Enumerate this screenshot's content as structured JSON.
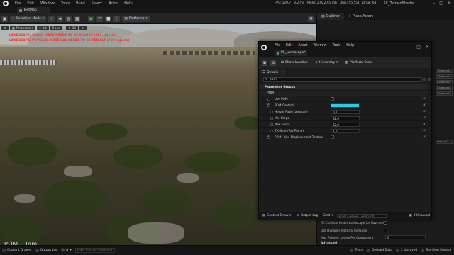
{
  "app": {
    "menu": [
      "File",
      "Edit",
      "Window",
      "Tools",
      "Build",
      "Select",
      "Actor",
      "Help"
    ],
    "stats": [
      "FPS: 120,7",
      "8,2 ms",
      "Mem: 2.022,91 mb",
      "Objs: 45.551",
      "Draw: 63"
    ],
    "project_name": "5C_TerrainShader",
    "map_tab": "TestMap"
  },
  "toolbar": {
    "mode": "Selection Mode",
    "platforms": "Platforms"
  },
  "viewport": {
    "perspective": "Perspective",
    "lit": "Lit",
    "show": "Show",
    "snap_value": "10",
    "warnings": [
      "LANDSCAPE: GRASS MAPS NEEDS TO BE REBUILT (252 objects)",
      "LANDSCAPE: PHYSICAL MATERIAL NEEDS TO BE REBUILT (252 objects)"
    ],
    "watermark": "POM - Tom"
  },
  "right_panel": {
    "tabs": [
      "Outliner",
      "Place Actors"
    ],
    "overflow_labels": [
      "(Orientatio",
      "(Orientatio",
      "(Orientatio",
      "(Orientatio",
      "(Orientatio"
    ],
    "edit_in_label": "Edit in C",
    "rows": [
      {
        "label": "Fill Collision Under Landscape for Navmesh"
      },
      {
        "label": "Use Dynamic Material Instance"
      },
      {
        "label": "Max Painted Layers Per Component",
        "value": "0"
      }
    ],
    "advanced": "Advanced"
  },
  "material_window": {
    "menu": [
      "File",
      "Edit",
      "Asset",
      "Window",
      "Tools",
      "Help"
    ],
    "tab_label": "MI_Landscape*",
    "toolbar": {
      "show_inactive": "Show Inactive",
      "hierarchy": "Hierarchy",
      "platform_stats": "Platform Stats"
    },
    "details_tab": "Details",
    "search_value": "pom",
    "groups": {
      "parameter_groups": "Parameter Groups",
      "pom": "POM"
    },
    "rows": [
      {
        "label": "Use POM",
        "checked": false,
        "type": "check",
        "value_checked": true
      },
      {
        "label": "POM Controls",
        "checked": true,
        "type": "color",
        "color": "#27cde6"
      },
      {
        "label": "Height Ratio (amount)",
        "checked": false,
        "type": "num",
        "value": "0,1"
      },
      {
        "label": "Min Steps",
        "checked": false,
        "type": "num",
        "value": "32,0"
      },
      {
        "label": "Max Steps",
        "checked": false,
        "type": "num",
        "value": "32,0"
      },
      {
        "label": "Z Offset (Ref Plane)",
        "checked": false,
        "type": "num",
        "value": "1,0"
      },
      {
        "label": "POM - Use Displacement Texture",
        "checked": true,
        "type": "check",
        "value_checked": false
      }
    ],
    "bottom": {
      "content_drawer": "Content Drawer",
      "output_log": "Output Log",
      "cmd": "Cmd",
      "console_placeholder": "Enter Console Command",
      "unsaved": "0 Unsaved"
    }
  },
  "statusbar": {
    "content_drawer": "Content Drawer",
    "output_log": "Output Log",
    "cmd": "Cmd",
    "console_placeholder": "Enter Console Command",
    "trace": "Trace",
    "derived_data": "Derived Data",
    "unsaved": "2 Unsaved",
    "revision_control": "Revision Control"
  }
}
